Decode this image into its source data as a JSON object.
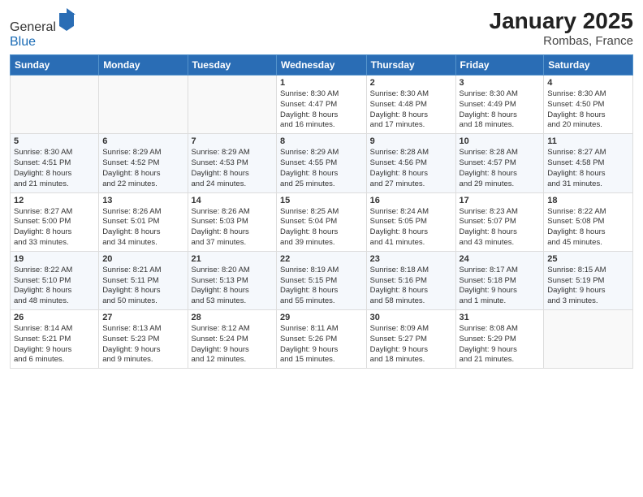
{
  "logo": {
    "general": "General",
    "blue": "Blue"
  },
  "title": "January 2025",
  "subtitle": "Rombas, France",
  "days_header": [
    "Sunday",
    "Monday",
    "Tuesday",
    "Wednesday",
    "Thursday",
    "Friday",
    "Saturday"
  ],
  "weeks": [
    [
      {
        "num": "",
        "info": ""
      },
      {
        "num": "",
        "info": ""
      },
      {
        "num": "",
        "info": ""
      },
      {
        "num": "1",
        "info": "Sunrise: 8:30 AM\nSunset: 4:47 PM\nDaylight: 8 hours\nand 16 minutes."
      },
      {
        "num": "2",
        "info": "Sunrise: 8:30 AM\nSunset: 4:48 PM\nDaylight: 8 hours\nand 17 minutes."
      },
      {
        "num": "3",
        "info": "Sunrise: 8:30 AM\nSunset: 4:49 PM\nDaylight: 8 hours\nand 18 minutes."
      },
      {
        "num": "4",
        "info": "Sunrise: 8:30 AM\nSunset: 4:50 PM\nDaylight: 8 hours\nand 20 minutes."
      }
    ],
    [
      {
        "num": "5",
        "info": "Sunrise: 8:30 AM\nSunset: 4:51 PM\nDaylight: 8 hours\nand 21 minutes."
      },
      {
        "num": "6",
        "info": "Sunrise: 8:29 AM\nSunset: 4:52 PM\nDaylight: 8 hours\nand 22 minutes."
      },
      {
        "num": "7",
        "info": "Sunrise: 8:29 AM\nSunset: 4:53 PM\nDaylight: 8 hours\nand 24 minutes."
      },
      {
        "num": "8",
        "info": "Sunrise: 8:29 AM\nSunset: 4:55 PM\nDaylight: 8 hours\nand 25 minutes."
      },
      {
        "num": "9",
        "info": "Sunrise: 8:28 AM\nSunset: 4:56 PM\nDaylight: 8 hours\nand 27 minutes."
      },
      {
        "num": "10",
        "info": "Sunrise: 8:28 AM\nSunset: 4:57 PM\nDaylight: 8 hours\nand 29 minutes."
      },
      {
        "num": "11",
        "info": "Sunrise: 8:27 AM\nSunset: 4:58 PM\nDaylight: 8 hours\nand 31 minutes."
      }
    ],
    [
      {
        "num": "12",
        "info": "Sunrise: 8:27 AM\nSunset: 5:00 PM\nDaylight: 8 hours\nand 33 minutes."
      },
      {
        "num": "13",
        "info": "Sunrise: 8:26 AM\nSunset: 5:01 PM\nDaylight: 8 hours\nand 34 minutes."
      },
      {
        "num": "14",
        "info": "Sunrise: 8:26 AM\nSunset: 5:03 PM\nDaylight: 8 hours\nand 37 minutes."
      },
      {
        "num": "15",
        "info": "Sunrise: 8:25 AM\nSunset: 5:04 PM\nDaylight: 8 hours\nand 39 minutes."
      },
      {
        "num": "16",
        "info": "Sunrise: 8:24 AM\nSunset: 5:05 PM\nDaylight: 8 hours\nand 41 minutes."
      },
      {
        "num": "17",
        "info": "Sunrise: 8:23 AM\nSunset: 5:07 PM\nDaylight: 8 hours\nand 43 minutes."
      },
      {
        "num": "18",
        "info": "Sunrise: 8:22 AM\nSunset: 5:08 PM\nDaylight: 8 hours\nand 45 minutes."
      }
    ],
    [
      {
        "num": "19",
        "info": "Sunrise: 8:22 AM\nSunset: 5:10 PM\nDaylight: 8 hours\nand 48 minutes."
      },
      {
        "num": "20",
        "info": "Sunrise: 8:21 AM\nSunset: 5:11 PM\nDaylight: 8 hours\nand 50 minutes."
      },
      {
        "num": "21",
        "info": "Sunrise: 8:20 AM\nSunset: 5:13 PM\nDaylight: 8 hours\nand 53 minutes."
      },
      {
        "num": "22",
        "info": "Sunrise: 8:19 AM\nSunset: 5:15 PM\nDaylight: 8 hours\nand 55 minutes."
      },
      {
        "num": "23",
        "info": "Sunrise: 8:18 AM\nSunset: 5:16 PM\nDaylight: 8 hours\nand 58 minutes."
      },
      {
        "num": "24",
        "info": "Sunrise: 8:17 AM\nSunset: 5:18 PM\nDaylight: 9 hours\nand 1 minute."
      },
      {
        "num": "25",
        "info": "Sunrise: 8:15 AM\nSunset: 5:19 PM\nDaylight: 9 hours\nand 3 minutes."
      }
    ],
    [
      {
        "num": "26",
        "info": "Sunrise: 8:14 AM\nSunset: 5:21 PM\nDaylight: 9 hours\nand 6 minutes."
      },
      {
        "num": "27",
        "info": "Sunrise: 8:13 AM\nSunset: 5:23 PM\nDaylight: 9 hours\nand 9 minutes."
      },
      {
        "num": "28",
        "info": "Sunrise: 8:12 AM\nSunset: 5:24 PM\nDaylight: 9 hours\nand 12 minutes."
      },
      {
        "num": "29",
        "info": "Sunrise: 8:11 AM\nSunset: 5:26 PM\nDaylight: 9 hours\nand 15 minutes."
      },
      {
        "num": "30",
        "info": "Sunrise: 8:09 AM\nSunset: 5:27 PM\nDaylight: 9 hours\nand 18 minutes."
      },
      {
        "num": "31",
        "info": "Sunrise: 8:08 AM\nSunset: 5:29 PM\nDaylight: 9 hours\nand 21 minutes."
      },
      {
        "num": "",
        "info": ""
      }
    ]
  ]
}
